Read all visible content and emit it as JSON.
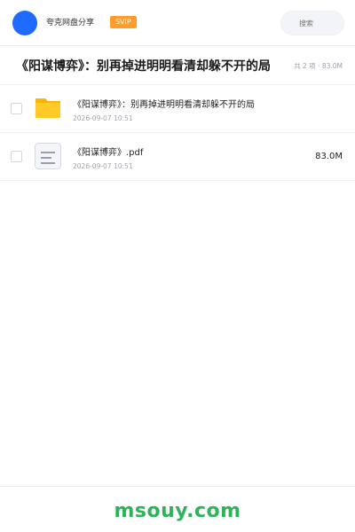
{
  "header": {
    "app_name": "夸克网盘分享",
    "badge": "SVIP",
    "search_placeholder": "搜索"
  },
  "folder": {
    "title": "《阳谋博弈》：别再掉进明明看清却躲不开的局",
    "meta": "共 2 项 · 83.0M"
  },
  "files": [
    {
      "type": "folder",
      "icon": "folder-icon",
      "name": "《阳谋博弈》：别再掉进明明看清却躲不开的局",
      "date": "2026-09-07 10:51",
      "size": ""
    },
    {
      "type": "pdf",
      "icon": "document-icon",
      "name": "《阳谋博弈》.pdf",
      "date": "2026-09-07 10:51",
      "size": "83.0M"
    }
  ],
  "footer": {
    "watermark": "msouy.com"
  },
  "colors": {
    "avatar": "#1f6bff",
    "badge": "#ff9c2b",
    "folder": "#ffc928",
    "watermark": "#2db45a"
  }
}
